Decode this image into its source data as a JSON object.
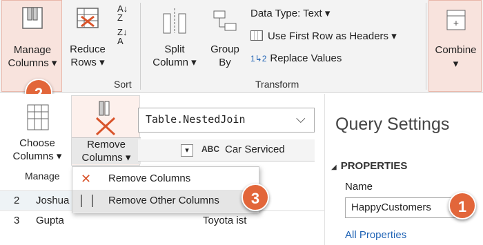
{
  "ribbon": {
    "manage_columns": [
      "Manage",
      "Columns ▾"
    ],
    "reduce_rows": [
      "Reduce",
      "Rows ▾"
    ],
    "sort_label": "Sort",
    "split_column": [
      "Split",
      "Column ▾"
    ],
    "group_by": [
      "Group",
      "By"
    ],
    "data_type": "Data Type: Text ▾",
    "use_first_row": "Use First Row as Headers ▾",
    "replace_values": "Replace Values",
    "transform_label": "Transform",
    "combine": "Combine",
    "combine_caret": "▾"
  },
  "sub_ribbon": {
    "choose_columns": [
      "Choose",
      "Columns ▾"
    ],
    "remove_columns": [
      "Remove",
      "Columns ▾"
    ],
    "manage_label": "Manage"
  },
  "formula_bar": {
    "text": "Table.NestedJoin"
  },
  "grid": {
    "header": "Car Serviced",
    "rows": [
      {
        "index": "2",
        "name": "Joshua"
      },
      {
        "index": "3",
        "name": "Gupta",
        "car": "Toyota ist"
      }
    ]
  },
  "dropdown": {
    "items": [
      "Remove Columns",
      "Remove Other Columns"
    ]
  },
  "query_settings": {
    "title": "Query Settings",
    "properties": "PROPERTIES",
    "name_label": "Name",
    "name_value": "HappyCustomers",
    "all_properties": "All Properties"
  },
  "badges": [
    "1",
    "2",
    "3"
  ],
  "colors": {
    "badge": "#e2663a",
    "highlight": "#f8e3dd",
    "remove_x": "#d9542b"
  }
}
